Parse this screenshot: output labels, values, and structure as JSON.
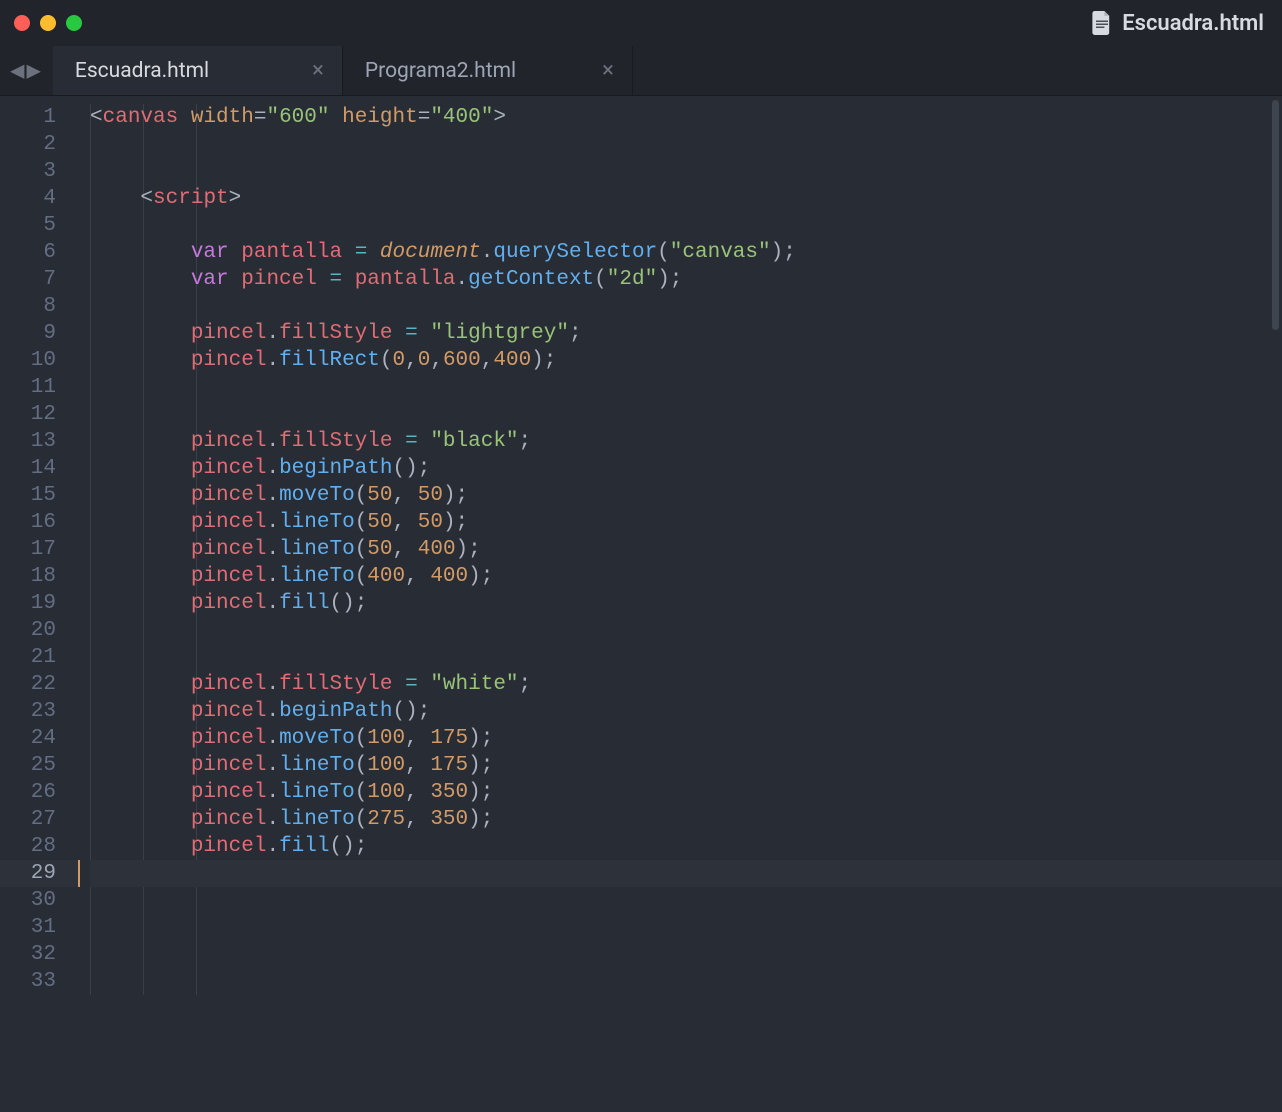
{
  "window": {
    "title": "Escuadra.html"
  },
  "tabs": [
    {
      "label": "Escuadra.html",
      "active": true
    },
    {
      "label": "Programa2.html",
      "active": false
    }
  ],
  "gutter": {
    "total_lines": 33,
    "active_line": 29
  },
  "code": {
    "lines": [
      {
        "n": 1,
        "indent": 0,
        "tokens": [
          [
            "p",
            "<"
          ],
          [
            "r",
            "canvas"
          ],
          [
            "p",
            " "
          ],
          [
            "o",
            "width"
          ],
          [
            "p",
            "="
          ],
          [
            "g",
            "\"600\""
          ],
          [
            "p",
            " "
          ],
          [
            "o",
            "height"
          ],
          [
            "p",
            "="
          ],
          [
            "g",
            "\"400\""
          ],
          [
            "p",
            ">"
          ]
        ]
      },
      {
        "n": 2,
        "indent": 0,
        "tokens": []
      },
      {
        "n": 3,
        "indent": 0,
        "tokens": []
      },
      {
        "n": 4,
        "indent": 1,
        "tokens": [
          [
            "p",
            "<"
          ],
          [
            "r",
            "script"
          ],
          [
            "p",
            ">"
          ]
        ]
      },
      {
        "n": 5,
        "indent": 1,
        "tokens": []
      },
      {
        "n": 6,
        "indent": 2,
        "tokens": [
          [
            "pu",
            "var"
          ],
          [
            "p",
            " "
          ],
          [
            "r",
            "pantalla"
          ],
          [
            "p",
            " "
          ],
          [
            "c",
            "="
          ],
          [
            "p",
            " "
          ],
          [
            "o",
            "document",
            "it"
          ],
          [
            "p",
            "."
          ],
          [
            "b",
            "querySelector"
          ],
          [
            "p",
            "("
          ],
          [
            "g",
            "\"canvas\""
          ],
          [
            "p",
            ");"
          ]
        ]
      },
      {
        "n": 7,
        "indent": 2,
        "tokens": [
          [
            "pu",
            "var"
          ],
          [
            "p",
            " "
          ],
          [
            "r",
            "pincel"
          ],
          [
            "p",
            " "
          ],
          [
            "c",
            "="
          ],
          [
            "p",
            " "
          ],
          [
            "r",
            "pantalla"
          ],
          [
            "p",
            "."
          ],
          [
            "b",
            "getContext"
          ],
          [
            "p",
            "("
          ],
          [
            "g",
            "\"2d\""
          ],
          [
            "p",
            ");"
          ]
        ]
      },
      {
        "n": 8,
        "indent": 2,
        "tokens": []
      },
      {
        "n": 9,
        "indent": 2,
        "tokens": [
          [
            "r",
            "pincel"
          ],
          [
            "p",
            "."
          ],
          [
            "r",
            "fillStyle"
          ],
          [
            "p",
            " "
          ],
          [
            "c",
            "="
          ],
          [
            "p",
            " "
          ],
          [
            "g",
            "\"lightgrey\""
          ],
          [
            "p",
            ";"
          ]
        ]
      },
      {
        "n": 10,
        "indent": 2,
        "tokens": [
          [
            "r",
            "pincel"
          ],
          [
            "p",
            "."
          ],
          [
            "b",
            "fillRect"
          ],
          [
            "p",
            "("
          ],
          [
            "o",
            "0"
          ],
          [
            "p",
            ","
          ],
          [
            "o",
            "0"
          ],
          [
            "p",
            ","
          ],
          [
            "o",
            "600"
          ],
          [
            "p",
            ","
          ],
          [
            "o",
            "400"
          ],
          [
            "p",
            ");"
          ]
        ]
      },
      {
        "n": 11,
        "indent": 2,
        "tokens": []
      },
      {
        "n": 12,
        "indent": 2,
        "tokens": []
      },
      {
        "n": 13,
        "indent": 2,
        "tokens": [
          [
            "r",
            "pincel"
          ],
          [
            "p",
            "."
          ],
          [
            "r",
            "fillStyle"
          ],
          [
            "p",
            " "
          ],
          [
            "c",
            "="
          ],
          [
            "p",
            " "
          ],
          [
            "g",
            "\"black\""
          ],
          [
            "p",
            ";"
          ]
        ]
      },
      {
        "n": 14,
        "indent": 2,
        "tokens": [
          [
            "r",
            "pincel"
          ],
          [
            "p",
            "."
          ],
          [
            "b",
            "beginPath"
          ],
          [
            "p",
            "();"
          ]
        ]
      },
      {
        "n": 15,
        "indent": 2,
        "tokens": [
          [
            "r",
            "pincel"
          ],
          [
            "p",
            "."
          ],
          [
            "b",
            "moveTo"
          ],
          [
            "p",
            "("
          ],
          [
            "o",
            "50"
          ],
          [
            "p",
            ", "
          ],
          [
            "o",
            "50"
          ],
          [
            "p",
            ");"
          ]
        ]
      },
      {
        "n": 16,
        "indent": 2,
        "tokens": [
          [
            "r",
            "pincel"
          ],
          [
            "p",
            "."
          ],
          [
            "b",
            "lineTo"
          ],
          [
            "p",
            "("
          ],
          [
            "o",
            "50"
          ],
          [
            "p",
            ", "
          ],
          [
            "o",
            "50"
          ],
          [
            "p",
            ");"
          ]
        ]
      },
      {
        "n": 17,
        "indent": 2,
        "tokens": [
          [
            "r",
            "pincel"
          ],
          [
            "p",
            "."
          ],
          [
            "b",
            "lineTo"
          ],
          [
            "p",
            "("
          ],
          [
            "o",
            "50"
          ],
          [
            "p",
            ", "
          ],
          [
            "o",
            "400"
          ],
          [
            "p",
            ");"
          ]
        ]
      },
      {
        "n": 18,
        "indent": 2,
        "tokens": [
          [
            "r",
            "pincel"
          ],
          [
            "p",
            "."
          ],
          [
            "b",
            "lineTo"
          ],
          [
            "p",
            "("
          ],
          [
            "o",
            "400"
          ],
          [
            "p",
            ", "
          ],
          [
            "o",
            "400"
          ],
          [
            "p",
            ");"
          ]
        ]
      },
      {
        "n": 19,
        "indent": 2,
        "tokens": [
          [
            "r",
            "pincel"
          ],
          [
            "p",
            "."
          ],
          [
            "b",
            "fill"
          ],
          [
            "p",
            "();"
          ]
        ]
      },
      {
        "n": 20,
        "indent": 2,
        "tokens": []
      },
      {
        "n": 21,
        "indent": 2,
        "tokens": []
      },
      {
        "n": 22,
        "indent": 2,
        "tokens": [
          [
            "r",
            "pincel"
          ],
          [
            "p",
            "."
          ],
          [
            "r",
            "fillStyle"
          ],
          [
            "p",
            " "
          ],
          [
            "c",
            "="
          ],
          [
            "p",
            " "
          ],
          [
            "g",
            "\"white\""
          ],
          [
            "p",
            ";"
          ]
        ]
      },
      {
        "n": 23,
        "indent": 2,
        "tokens": [
          [
            "r",
            "pincel"
          ],
          [
            "p",
            "."
          ],
          [
            "b",
            "beginPath"
          ],
          [
            "p",
            "();"
          ]
        ]
      },
      {
        "n": 24,
        "indent": 2,
        "tokens": [
          [
            "r",
            "pincel"
          ],
          [
            "p",
            "."
          ],
          [
            "b",
            "moveTo"
          ],
          [
            "p",
            "("
          ],
          [
            "o",
            "100"
          ],
          [
            "p",
            ", "
          ],
          [
            "o",
            "175"
          ],
          [
            "p",
            ");"
          ]
        ]
      },
      {
        "n": 25,
        "indent": 2,
        "tokens": [
          [
            "r",
            "pincel"
          ],
          [
            "p",
            "."
          ],
          [
            "b",
            "lineTo"
          ],
          [
            "p",
            "("
          ],
          [
            "o",
            "100"
          ],
          [
            "p",
            ", "
          ],
          [
            "o",
            "175"
          ],
          [
            "p",
            ");"
          ]
        ]
      },
      {
        "n": 26,
        "indent": 2,
        "tokens": [
          [
            "r",
            "pincel"
          ],
          [
            "p",
            "."
          ],
          [
            "b",
            "lineTo"
          ],
          [
            "p",
            "("
          ],
          [
            "o",
            "100"
          ],
          [
            "p",
            ", "
          ],
          [
            "o",
            "350"
          ],
          [
            "p",
            ");"
          ]
        ]
      },
      {
        "n": 27,
        "indent": 2,
        "tokens": [
          [
            "r",
            "pincel"
          ],
          [
            "p",
            "."
          ],
          [
            "b",
            "lineTo"
          ],
          [
            "p",
            "("
          ],
          [
            "o",
            "275"
          ],
          [
            "p",
            ", "
          ],
          [
            "o",
            "350"
          ],
          [
            "p",
            ");"
          ]
        ]
      },
      {
        "n": 28,
        "indent": 2,
        "tokens": [
          [
            "r",
            "pincel"
          ],
          [
            "p",
            "."
          ],
          [
            "b",
            "fill"
          ],
          [
            "p",
            "();"
          ]
        ]
      },
      {
        "n": 29,
        "indent": 0,
        "tokens": [],
        "active": true
      },
      {
        "n": 30,
        "indent": 0,
        "tokens": []
      },
      {
        "n": 31,
        "indent": 0,
        "tokens": []
      },
      {
        "n": 32,
        "indent": 0,
        "tokens": []
      },
      {
        "n": 33,
        "indent": 0,
        "tokens": []
      }
    ]
  }
}
